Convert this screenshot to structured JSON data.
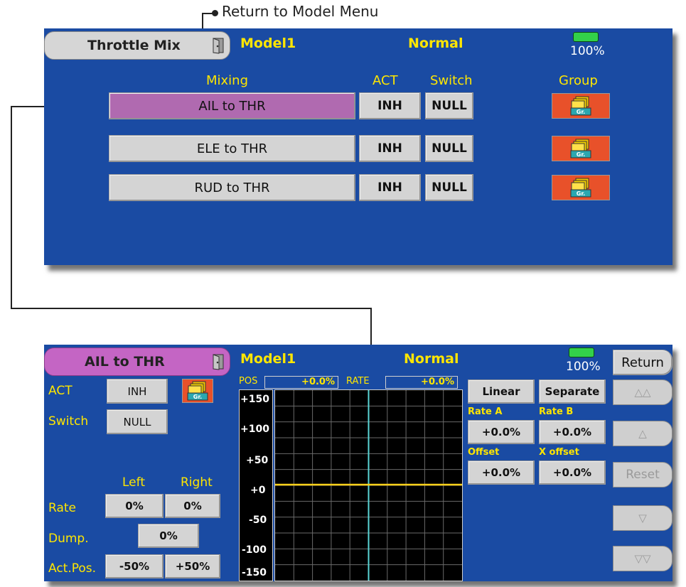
{
  "annotation": {
    "return_label": "Return to Model Menu"
  },
  "top": {
    "tab_title": "Throttle Mix",
    "model": "Model1",
    "condition": "Normal",
    "battery": "100%",
    "headers": {
      "mixing": "Mixing",
      "act": "ACT",
      "switch": "Switch",
      "group": "Group"
    },
    "rows": [
      {
        "name": "AIL to THR",
        "act": "INH",
        "switch": "NULL"
      },
      {
        "name": "ELE to THR",
        "act": "INH",
        "switch": "NULL"
      },
      {
        "name": "RUD to THR",
        "act": "INH",
        "switch": "NULL"
      }
    ],
    "group_icon_label": "Gr."
  },
  "bottom": {
    "tab_title": "AIL to THR",
    "model": "Model1",
    "condition": "Normal",
    "battery": "100%",
    "return_label": "Return",
    "act_label": "ACT",
    "act_value": "INH",
    "switch_label": "Switch",
    "switch_value": "NULL",
    "group_icon_label": "Gr.",
    "left_label": "Left",
    "right_label": "Right",
    "rate_label": "Rate",
    "rate_left": "0%",
    "rate_right": "0%",
    "dump_label": "Dump.",
    "dump_value": "0%",
    "actpos_label": "Act.Pos.",
    "actpos_left": "-50%",
    "actpos_right": "+50%",
    "pos_label": "POS",
    "pos_value": "+0.0%",
    "rate_hdr_label": "RATE",
    "rate_hdr_value": "+0.0%",
    "y_ticks": [
      "+150",
      "+100",
      "+50",
      "+0",
      "-50",
      "-100",
      "-150"
    ],
    "linear_label": "Linear",
    "separate_label": "Separate",
    "rate_a_label": "Rate A",
    "rate_a_value": "+0.0%",
    "rate_b_label": "Rate B",
    "rate_b_value": "+0.0%",
    "offset_label": "Offset",
    "offset_value": "+0.0%",
    "xoffset_label": "X offset",
    "xoffset_value": "+0.0%",
    "side": {
      "up2": "△△",
      "up1": "△",
      "reset": "Reset",
      "down1": "▽",
      "down2": "▽▽"
    }
  },
  "colors": {
    "panel": "#1a4ba3",
    "selected": "#b06ab0",
    "curve": "#ffd21a",
    "cursor": "#5ad6d6",
    "group": "#e8512a"
  }
}
